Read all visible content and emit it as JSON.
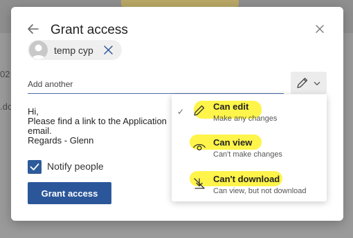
{
  "background": {
    "row1_text": "02",
    "row2_text": ".do"
  },
  "dialog": {
    "title": "Grant access",
    "recipient": {
      "name": "temp cyp"
    },
    "add_another": {
      "placeholder": "Add another",
      "value": ""
    },
    "message_lines": [
      "Hi,",
      "Please find a link to the Application",
      "email.",
      "Regards - Glenn"
    ],
    "notify": {
      "label": "Notify people",
      "checked": true
    },
    "grant_button": "Grant access"
  },
  "permission_menu": {
    "items": [
      {
        "title": "Can edit",
        "subtitle": "Make any changes",
        "icon": "pencil-icon",
        "selected": true
      },
      {
        "title": "Can view",
        "subtitle": "Can't make changes",
        "icon": "eye-icon",
        "selected": false
      },
      {
        "title": "Can't download",
        "subtitle": "Can view, but not download",
        "icon": "no-download-icon",
        "selected": false
      }
    ],
    "highlight_color": "#fff44a"
  },
  "colors": {
    "primary": "#2b579a",
    "overlay": "#8a8a8a"
  }
}
